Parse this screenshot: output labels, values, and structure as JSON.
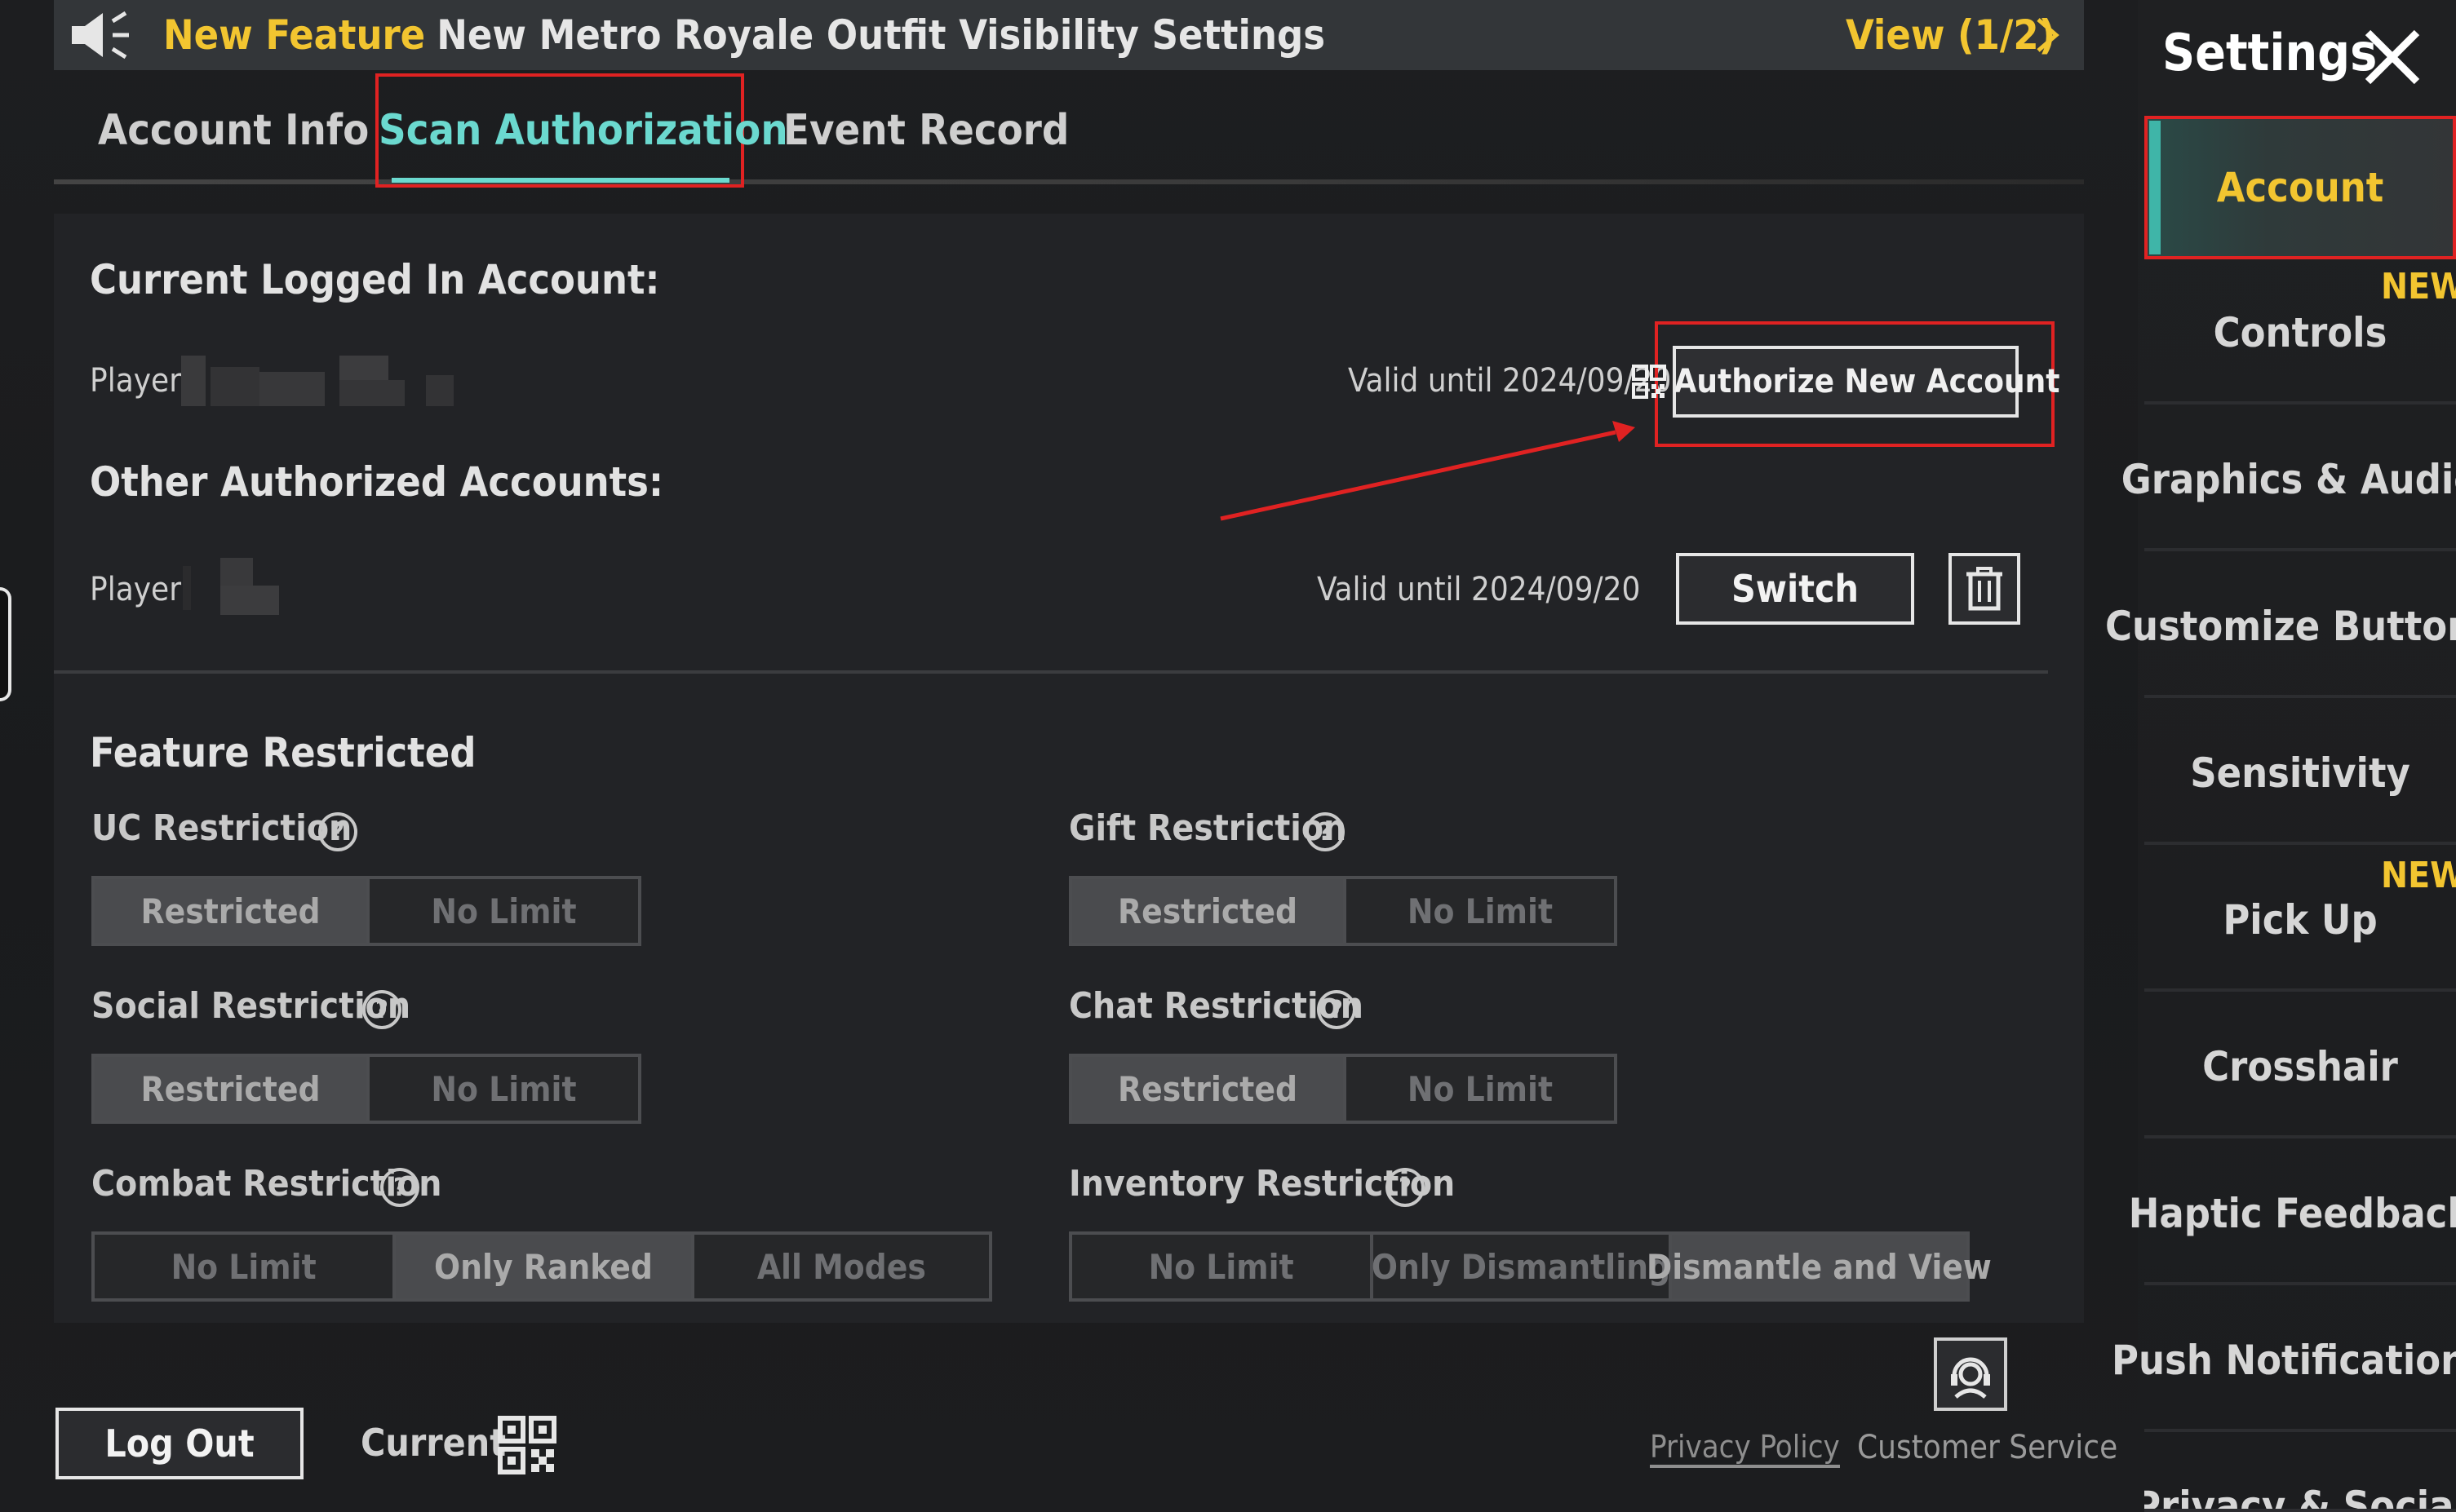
{
  "banner": {
    "new_label": "New Feature",
    "title": "New Metro Royale Outfit Visibility Settings",
    "view_label": "View (1/2)"
  },
  "tabs": [
    {
      "label": "Account Info"
    },
    {
      "label": "Scan Authorization",
      "active": true
    },
    {
      "label": "Event Record"
    }
  ],
  "current": {
    "heading": "Current Logged In Account:",
    "player_label": "Player:",
    "valid": "Valid until 2024/09/20",
    "authorize_label": "Authorize New Account"
  },
  "other": {
    "heading": "Other Authorized Accounts:",
    "player_label": "Player:",
    "valid": "Valid until 2024/09/20",
    "switch_label": "Switch"
  },
  "features": {
    "heading": "Feature Restricted",
    "uc": {
      "label": "UC Restriction",
      "options": [
        "Restricted",
        "No Limit"
      ],
      "selected": 0
    },
    "gift": {
      "label": "Gift Restriction",
      "options": [
        "Restricted",
        "No Limit"
      ],
      "selected": 0
    },
    "social": {
      "label": "Social Restriction",
      "options": [
        "Restricted",
        "No Limit"
      ],
      "selected": 0
    },
    "chat": {
      "label": "Chat Restriction",
      "options": [
        "Restricted",
        "No Limit"
      ],
      "selected": 0
    },
    "combat": {
      "label": "Combat Restriction",
      "options": [
        "No Limit",
        "Only Ranked",
        "All Modes"
      ],
      "selected": 1
    },
    "inventory": {
      "label": "Inventory Restriction",
      "options": [
        "No Limit",
        "Only Dismantling",
        "Dismantle and View"
      ],
      "selected": 2
    }
  },
  "footer": {
    "logout_label": "Log Out",
    "current_label": "Current",
    "privacy_label": "Privacy Policy",
    "cs_label": "Customer Service"
  },
  "sidebar": {
    "title": "Settings",
    "new_badge": "NEW",
    "items": [
      {
        "label": "Account",
        "active": true
      },
      {
        "label": "Controls",
        "new": true
      },
      {
        "label": "Graphics & Audio"
      },
      {
        "label": "Customize Buttons"
      },
      {
        "label": "Sensitivity"
      },
      {
        "label": "Pick Up",
        "new": true
      },
      {
        "label": "Crosshair"
      },
      {
        "label": "Haptic Feedback"
      },
      {
        "label": "Push Notifications"
      },
      {
        "label": "Privacy & Social"
      }
    ]
  },
  "colors": {
    "accent_teal": "#6bd9cf",
    "accent_yellow": "#f2c530",
    "highlight_red": "#e02222"
  },
  "icons": {
    "speaker": "speaker-icon",
    "chevron": "chevron-right-icon",
    "qr": "qr-code-icon",
    "trash": "trash-icon",
    "help": "help-circle-icon",
    "close": "close-icon",
    "customer_service": "customer-service-icon"
  }
}
